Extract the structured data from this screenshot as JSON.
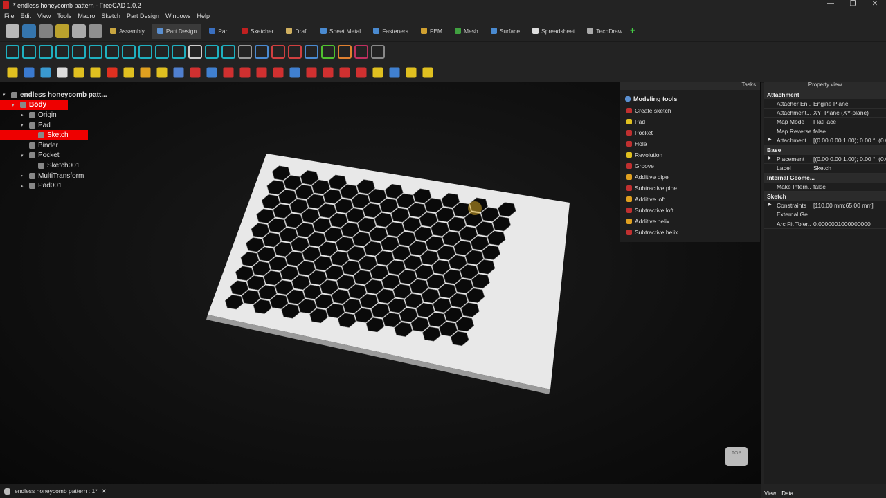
{
  "window": {
    "title": "* endless honeycomb pattern - FreeCAD 1.0.2",
    "controls": [
      "—",
      "❐",
      "✕"
    ]
  },
  "menu": [
    "File",
    "Edit",
    "View",
    "Tools",
    "Macro",
    "Sketch",
    "Part Design",
    "Windows",
    "Help"
  ],
  "workbenches": [
    {
      "label": "Assembly",
      "color": "#c9a640"
    },
    {
      "label": "Part Design",
      "color": "#5a8fd0",
      "active": true
    },
    {
      "label": "Part",
      "color": "#3a6fc0"
    },
    {
      "label": "Sketcher",
      "color": "#c02020"
    },
    {
      "label": "Draft",
      "color": "#d0b060"
    },
    {
      "label": "Sheet Metal",
      "color": "#4a8ad0"
    },
    {
      "label": "Fasteners",
      "color": "#4a8ad0"
    },
    {
      "label": "FEM",
      "color": "#d0a030"
    },
    {
      "label": "Mesh",
      "color": "#40a040"
    },
    {
      "label": "Surface",
      "color": "#4a8ad0"
    },
    {
      "label": "Spreadsheet",
      "color": "#dddddd"
    },
    {
      "label": "TechDraw",
      "color": "#aaaaaa"
    }
  ],
  "tree": [
    {
      "label": "endless honeycomb patt...",
      "depth": 0,
      "twisty": "▾",
      "bold": true
    },
    {
      "label": "Body",
      "depth": 1,
      "twisty": "▾",
      "selected": true,
      "bold": true
    },
    {
      "label": "Origin",
      "depth": 2,
      "twisty": "▸"
    },
    {
      "label": "Pad",
      "depth": 2,
      "twisty": "▾"
    },
    {
      "label": "Sketch",
      "depth": 3,
      "twisty": "",
      "selected": true
    },
    {
      "label": "Binder",
      "depth": 2,
      "twisty": ""
    },
    {
      "label": "Pocket",
      "depth": 2,
      "twisty": "▾"
    },
    {
      "label": "Sketch001",
      "depth": 3,
      "twisty": ""
    },
    {
      "label": "MultiTransform",
      "depth": 2,
      "twisty": "▸"
    },
    {
      "label": "Pad001",
      "depth": 2,
      "twisty": "▸"
    }
  ],
  "tasks": {
    "header": "Tasks",
    "title": "Modeling tools",
    "tools": [
      {
        "label": "Create sketch",
        "color": "#c03030"
      },
      {
        "label": "Pad",
        "color": "#e0c020"
      },
      {
        "label": "Pocket",
        "color": "#c03030"
      },
      {
        "label": "Hole",
        "color": "#c03030"
      },
      {
        "label": "Revolution",
        "color": "#e0c020"
      },
      {
        "label": "Groove",
        "color": "#c03030"
      },
      {
        "label": "Additive pipe",
        "color": "#e0a020"
      },
      {
        "label": "Subtractive pipe",
        "color": "#c03030"
      },
      {
        "label": "Additive loft",
        "color": "#e0a020"
      },
      {
        "label": "Subtractive loft",
        "color": "#c03030"
      },
      {
        "label": "Additive helix",
        "color": "#e0a020"
      },
      {
        "label": "Subtractive helix",
        "color": "#c03030"
      }
    ]
  },
  "properties": {
    "header": "Property view",
    "groups": [
      {
        "name": "Attachment",
        "rows": [
          {
            "k": "Attacher En...",
            "v": "Engine Plane"
          },
          {
            "k": "Attachment...",
            "v": "XY_Plane (XY-plane)"
          },
          {
            "k": "Map Mode",
            "v": "FlatFace"
          },
          {
            "k": "Map Reversed",
            "v": "false"
          },
          {
            "k": "Attachment...",
            "v": "[(0.00 0.00 1.00); 0.00 °; (0.0...",
            "exp": true
          }
        ]
      },
      {
        "name": "Base",
        "rows": [
          {
            "k": "Placement",
            "v": "[(0.00 0.00 1.00); 0.00 °; (0.0...",
            "exp": true
          },
          {
            "k": "Label",
            "v": "Sketch"
          }
        ]
      },
      {
        "name": "Internal Geome...",
        "rows": [
          {
            "k": "Make Intern...",
            "v": "false"
          }
        ]
      },
      {
        "name": "Sketch",
        "rows": [
          {
            "k": "Constraints",
            "v": "[110.00 mm;65.00 mm]",
            "exp": true
          },
          {
            "k": "External Ge...",
            "v": ""
          },
          {
            "k": "Arc Fit Toler...",
            "v": "0.0000001000000000"
          }
        ]
      }
    ],
    "tabs": [
      "View",
      "Data"
    ]
  },
  "status": {
    "doc_tab": "endless honeycomb pattern : 1*"
  },
  "navcube": {
    "face": "TOP"
  }
}
